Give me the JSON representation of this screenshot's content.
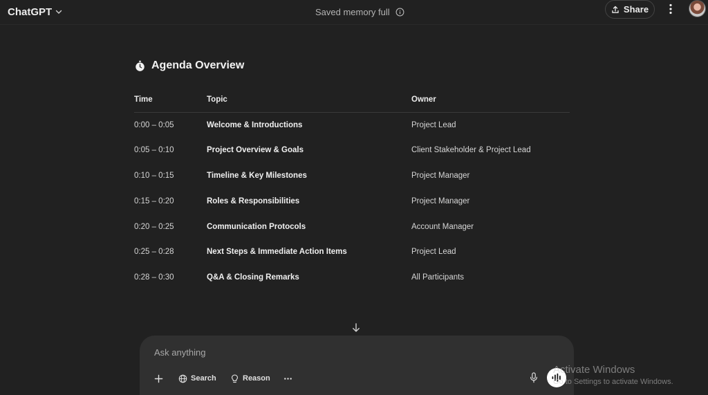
{
  "header": {
    "brand": "ChatGPT",
    "memory_status": "Saved memory full",
    "share_label": "Share"
  },
  "agenda": {
    "title": "Agenda Overview",
    "columns": [
      "Time",
      "Topic",
      "Owner"
    ],
    "rows": [
      {
        "time": "0:00 – 0:05",
        "topic": "Welcome & Introductions",
        "owner": "Project Lead"
      },
      {
        "time": "0:05 – 0:10",
        "topic": "Project Overview & Goals",
        "owner": "Client Stakeholder & Project Lead"
      },
      {
        "time": "0:10 – 0:15",
        "topic": "Timeline & Key Milestones",
        "owner": "Project Manager"
      },
      {
        "time": "0:15 – 0:20",
        "topic": "Roles & Responsibilities",
        "owner": "Project Manager"
      },
      {
        "time": "0:20 – 0:25",
        "topic": "Communication Protocols",
        "owner": "Account Manager"
      },
      {
        "time": "0:25 – 0:28",
        "topic": "Next Steps & Immediate Action Items",
        "owner": "Project Lead"
      },
      {
        "time": "0:28 – 0:30",
        "topic": "Q&A & Closing Remarks",
        "owner": "All Participants"
      }
    ]
  },
  "composer": {
    "placeholder": "Ask anything",
    "tools": {
      "search": "Search",
      "reason": "Reason"
    }
  },
  "watermark": {
    "line1": "Activate Windows",
    "line2": "Go to Settings to activate Windows."
  },
  "icons": {
    "title_icon": "stopwatch-icon",
    "scroll": "arrow-down-icon",
    "mic": "microphone-icon",
    "voice": "voice-mode-icon"
  },
  "colors": {
    "background": "#212121",
    "composer": "#303030",
    "text": "#ececec"
  }
}
